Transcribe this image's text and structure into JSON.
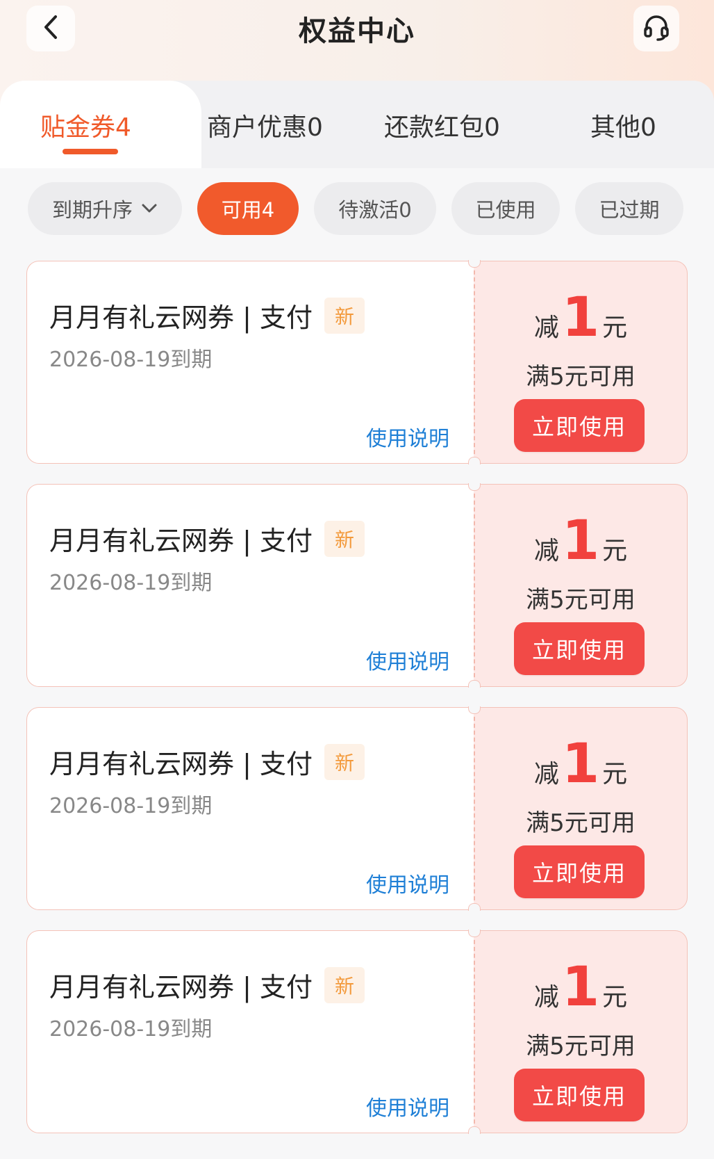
{
  "header": {
    "title": "权益中心",
    "back_icon": "chevron-left-icon",
    "service_icon": "headset-icon"
  },
  "tabs": [
    {
      "label": "贴金券4",
      "active": true
    },
    {
      "label": "商户优惠0",
      "active": false
    },
    {
      "label": "还款红包0",
      "active": false
    },
    {
      "label": "其他0",
      "active": false
    }
  ],
  "filters": {
    "sort_label": "到期升序",
    "chips": [
      {
        "label": "可用4",
        "active": true
      },
      {
        "label": "待激活0",
        "active": false
      },
      {
        "label": "已使用",
        "active": false
      },
      {
        "label": "已过期",
        "active": false
      }
    ]
  },
  "coupons": [
    {
      "title": "月月有礼云网券 | 支付",
      "badge": "新",
      "expiry": "2026-08-19到期",
      "rules_link": "使用说明",
      "amount_prefix": "减",
      "amount": "1",
      "amount_unit": "元",
      "condition": "满5元可用",
      "button": "立即使用"
    },
    {
      "title": "月月有礼云网券 | 支付",
      "badge": "新",
      "expiry": "2026-08-19到期",
      "rules_link": "使用说明",
      "amount_prefix": "减",
      "amount": "1",
      "amount_unit": "元",
      "condition": "满5元可用",
      "button": "立即使用"
    },
    {
      "title": "月月有礼云网券 | 支付",
      "badge": "新",
      "expiry": "2026-08-19到期",
      "rules_link": "使用说明",
      "amount_prefix": "减",
      "amount": "1",
      "amount_unit": "元",
      "condition": "满5元可用",
      "button": "立即使用"
    },
    {
      "title": "月月有礼云网券 | 支付",
      "badge": "新",
      "expiry": "2026-08-19到期",
      "rules_link": "使用说明",
      "amount_prefix": "减",
      "amount": "1",
      "amount_unit": "元",
      "condition": "满5元可用",
      "button": "立即使用"
    }
  ],
  "colors": {
    "accent": "#f05a2a",
    "button_red": "#f24a47",
    "link_blue": "#1e7fd6",
    "coupon_right_bg": "#fde8e6"
  }
}
